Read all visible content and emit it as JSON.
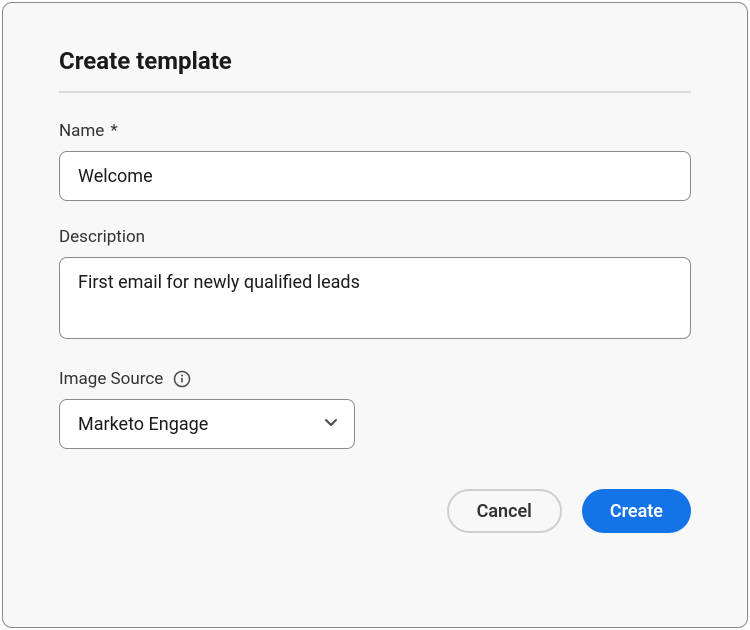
{
  "dialog": {
    "title": "Create template"
  },
  "fields": {
    "name": {
      "label": "Name",
      "required_marker": "*",
      "value": "Welcome"
    },
    "description": {
      "label": "Description",
      "value": "First email for newly qualified leads"
    },
    "imageSource": {
      "label": "Image Source",
      "selected": "Marketo Engage"
    }
  },
  "buttons": {
    "cancel": "Cancel",
    "create": "Create"
  },
  "colors": {
    "primary": "#1473e6"
  }
}
